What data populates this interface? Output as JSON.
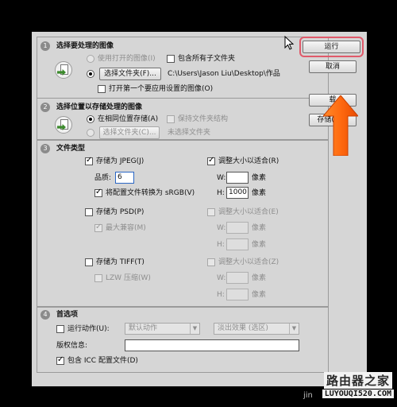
{
  "section1": {
    "num": "1",
    "title": "选择要处理的图像",
    "use_open_label": "使用打开的图像(I)",
    "include_subfolders_label": "包含所有子文件夹",
    "choose_folder_btn": "选择文件夹(F)...",
    "folder_path": "C:\\Users\\Jason Liu\\Desktop\\作品",
    "open_first_label": "打开第一个要应用设置的图像(O)"
  },
  "section2": {
    "num": "2",
    "title": "选择位置以存储处理的图像",
    "same_location_label": "在相同位置存储(A)",
    "keep_structure_label": "保持文件夹结构",
    "choose_folder_btn": "选择文件夹(C)...",
    "no_folder_label": "未选择文件夹"
  },
  "section3": {
    "num": "3",
    "title": "文件类型",
    "jpeg": {
      "save_label": "存储为 JPEG(J)",
      "resize_label": "调整大小以适合(R)",
      "quality_label": "品质:",
      "quality_value": "6",
      "w_label": "W:",
      "w_value": "",
      "w_unit": "像素",
      "convert_label": "将配置文件转换为 sRGB(V)",
      "h_label": "H:",
      "h_value": "1000",
      "h_unit": "像素"
    },
    "psd": {
      "save_label": "存储为 PSD(P)",
      "resize_label": "调整大小以适合(E)",
      "max_compat_label": "最大兼容(M)",
      "w_label": "W:",
      "w_unit": "像素",
      "h_label": "H:",
      "h_unit": "像素"
    },
    "tiff": {
      "save_label": "存储为 TIFF(T)",
      "resize_label": "调整大小以适合(Z)",
      "lzw_label": "LZW 压缩(W)",
      "w_label": "W:",
      "w_unit": "像素",
      "h_label": "H:",
      "h_unit": "像素"
    }
  },
  "section4": {
    "num": "4",
    "title": "首选项",
    "run_action_label": "运行动作(U):",
    "action_set": "默认动作",
    "action_name": "淡出效果 (选区)",
    "copyright_label": "版权信息:",
    "copyright_value": "",
    "include_icc_label": "包含 ICC 配置文件(D)"
  },
  "buttons": {
    "run": "运行",
    "cancel": "取消",
    "load": "载",
    "save": "存储(S)..."
  },
  "watermark": {
    "site": "路由器之家",
    "url": "LUYOUQI520.COM",
    "ji": "jin"
  }
}
